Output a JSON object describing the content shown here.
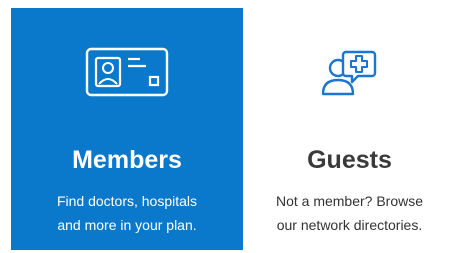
{
  "members": {
    "title": "Members",
    "desc_line1": "Find doctors, hospitals",
    "desc_line2": "and more in your plan.",
    "icon": "id-card-icon",
    "bg_color": "#0a79cc"
  },
  "guests": {
    "title": "Guests",
    "desc_line1": "Not a member? Browse",
    "desc_line2": "our network directories.",
    "icon": "person-medical-chat-icon",
    "icon_color": "#1976d2"
  }
}
